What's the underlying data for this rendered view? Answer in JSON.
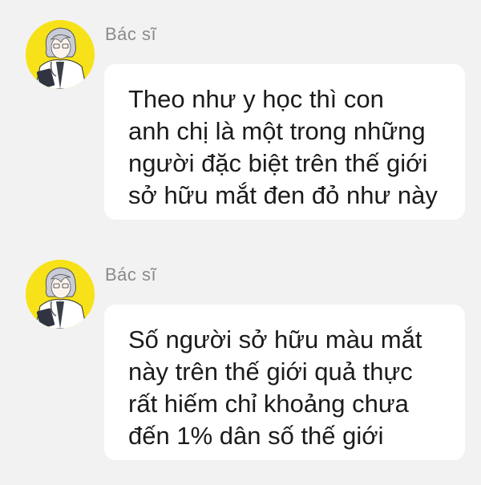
{
  "colors": {
    "background": "#f2f2f2",
    "bubble": "#ffffff",
    "avatar_bg": "#f7e21a",
    "sender_text": "#8a8a8a",
    "message_text": "#1b1b1b"
  },
  "messages": [
    {
      "sender": "Bác sĩ",
      "avatar_icon": "doctor-avatar-icon",
      "lines": [
        "Theo như y học thì con",
        "anh chị là một trong những",
        "người đặc biệt trên thế giới",
        "sở hữu mắt đen đỏ như này"
      ]
    },
    {
      "sender": "Bác sĩ",
      "avatar_icon": "doctor-avatar-icon",
      "lines": [
        "Số người sở hữu màu mắt",
        "này trên thế giới quả thực",
        "rất hiếm chỉ khoảng chưa",
        "đến 1% dân số thế giới"
      ]
    }
  ]
}
